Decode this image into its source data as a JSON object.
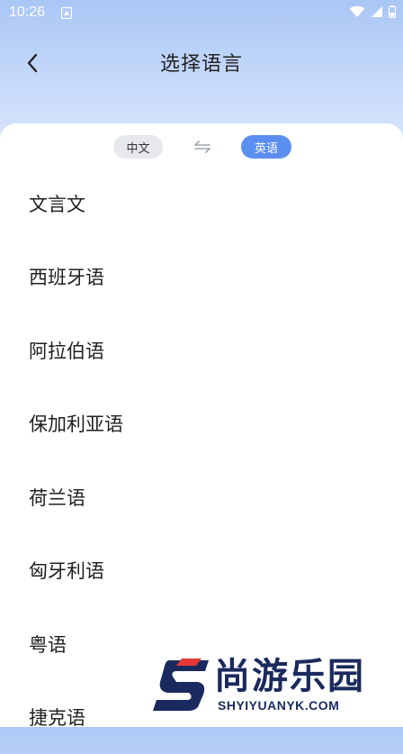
{
  "status_bar": {
    "time": "10:26"
  },
  "header": {
    "title": "选择语言"
  },
  "switch": {
    "source": "中文",
    "target": "英语"
  },
  "languages": [
    "文言文",
    "西班牙语",
    "阿拉伯语",
    "保加利亚语",
    "荷兰语",
    "匈牙利语",
    "粤语",
    "捷克语"
  ],
  "watermark": {
    "name": "尚游乐园",
    "domain": "SHYIYUANYK.COM"
  },
  "colors": {
    "accent": "#5b8ef1",
    "header_bg": "#a9c6f4"
  }
}
